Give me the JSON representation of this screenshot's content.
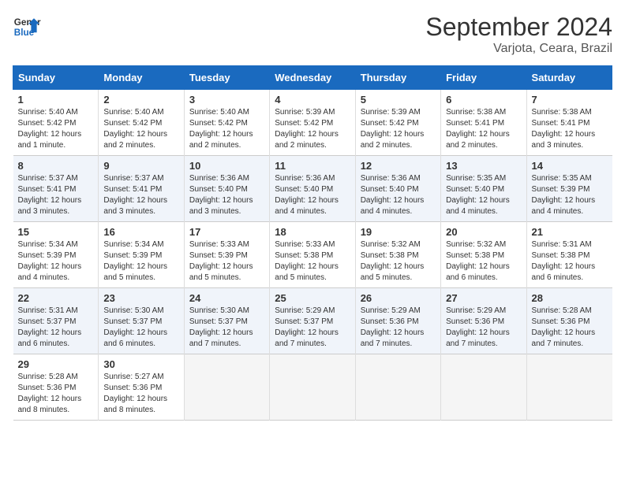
{
  "logo": {
    "line1": "General",
    "line2": "Blue"
  },
  "title": "September 2024",
  "location": "Varjota, Ceara, Brazil",
  "days_header": [
    "Sunday",
    "Monday",
    "Tuesday",
    "Wednesday",
    "Thursday",
    "Friday",
    "Saturday"
  ],
  "weeks": [
    [
      {
        "num": "1",
        "info": "Sunrise: 5:40 AM\nSunset: 5:42 PM\nDaylight: 12 hours\nand 1 minute."
      },
      {
        "num": "2",
        "info": "Sunrise: 5:40 AM\nSunset: 5:42 PM\nDaylight: 12 hours\nand 2 minutes."
      },
      {
        "num": "3",
        "info": "Sunrise: 5:40 AM\nSunset: 5:42 PM\nDaylight: 12 hours\nand 2 minutes."
      },
      {
        "num": "4",
        "info": "Sunrise: 5:39 AM\nSunset: 5:42 PM\nDaylight: 12 hours\nand 2 minutes."
      },
      {
        "num": "5",
        "info": "Sunrise: 5:39 AM\nSunset: 5:42 PM\nDaylight: 12 hours\nand 2 minutes."
      },
      {
        "num": "6",
        "info": "Sunrise: 5:38 AM\nSunset: 5:41 PM\nDaylight: 12 hours\nand 2 minutes."
      },
      {
        "num": "7",
        "info": "Sunrise: 5:38 AM\nSunset: 5:41 PM\nDaylight: 12 hours\nand 3 minutes."
      }
    ],
    [
      {
        "num": "8",
        "info": "Sunrise: 5:37 AM\nSunset: 5:41 PM\nDaylight: 12 hours\nand 3 minutes."
      },
      {
        "num": "9",
        "info": "Sunrise: 5:37 AM\nSunset: 5:41 PM\nDaylight: 12 hours\nand 3 minutes."
      },
      {
        "num": "10",
        "info": "Sunrise: 5:36 AM\nSunset: 5:40 PM\nDaylight: 12 hours\nand 3 minutes."
      },
      {
        "num": "11",
        "info": "Sunrise: 5:36 AM\nSunset: 5:40 PM\nDaylight: 12 hours\nand 4 minutes."
      },
      {
        "num": "12",
        "info": "Sunrise: 5:36 AM\nSunset: 5:40 PM\nDaylight: 12 hours\nand 4 minutes."
      },
      {
        "num": "13",
        "info": "Sunrise: 5:35 AM\nSunset: 5:40 PM\nDaylight: 12 hours\nand 4 minutes."
      },
      {
        "num": "14",
        "info": "Sunrise: 5:35 AM\nSunset: 5:39 PM\nDaylight: 12 hours\nand 4 minutes."
      }
    ],
    [
      {
        "num": "15",
        "info": "Sunrise: 5:34 AM\nSunset: 5:39 PM\nDaylight: 12 hours\nand 4 minutes."
      },
      {
        "num": "16",
        "info": "Sunrise: 5:34 AM\nSunset: 5:39 PM\nDaylight: 12 hours\nand 5 minutes."
      },
      {
        "num": "17",
        "info": "Sunrise: 5:33 AM\nSunset: 5:39 PM\nDaylight: 12 hours\nand 5 minutes."
      },
      {
        "num": "18",
        "info": "Sunrise: 5:33 AM\nSunset: 5:38 PM\nDaylight: 12 hours\nand 5 minutes."
      },
      {
        "num": "19",
        "info": "Sunrise: 5:32 AM\nSunset: 5:38 PM\nDaylight: 12 hours\nand 5 minutes."
      },
      {
        "num": "20",
        "info": "Sunrise: 5:32 AM\nSunset: 5:38 PM\nDaylight: 12 hours\nand 6 minutes."
      },
      {
        "num": "21",
        "info": "Sunrise: 5:31 AM\nSunset: 5:38 PM\nDaylight: 12 hours\nand 6 minutes."
      }
    ],
    [
      {
        "num": "22",
        "info": "Sunrise: 5:31 AM\nSunset: 5:37 PM\nDaylight: 12 hours\nand 6 minutes."
      },
      {
        "num": "23",
        "info": "Sunrise: 5:30 AM\nSunset: 5:37 PM\nDaylight: 12 hours\nand 6 minutes."
      },
      {
        "num": "24",
        "info": "Sunrise: 5:30 AM\nSunset: 5:37 PM\nDaylight: 12 hours\nand 7 minutes."
      },
      {
        "num": "25",
        "info": "Sunrise: 5:29 AM\nSunset: 5:37 PM\nDaylight: 12 hours\nand 7 minutes."
      },
      {
        "num": "26",
        "info": "Sunrise: 5:29 AM\nSunset: 5:36 PM\nDaylight: 12 hours\nand 7 minutes."
      },
      {
        "num": "27",
        "info": "Sunrise: 5:29 AM\nSunset: 5:36 PM\nDaylight: 12 hours\nand 7 minutes."
      },
      {
        "num": "28",
        "info": "Sunrise: 5:28 AM\nSunset: 5:36 PM\nDaylight: 12 hours\nand 7 minutes."
      }
    ],
    [
      {
        "num": "29",
        "info": "Sunrise: 5:28 AM\nSunset: 5:36 PM\nDaylight: 12 hours\nand 8 minutes."
      },
      {
        "num": "30",
        "info": "Sunrise: 5:27 AM\nSunset: 5:36 PM\nDaylight: 12 hours\nand 8 minutes."
      },
      {
        "num": "",
        "info": ""
      },
      {
        "num": "",
        "info": ""
      },
      {
        "num": "",
        "info": ""
      },
      {
        "num": "",
        "info": ""
      },
      {
        "num": "",
        "info": ""
      }
    ]
  ]
}
